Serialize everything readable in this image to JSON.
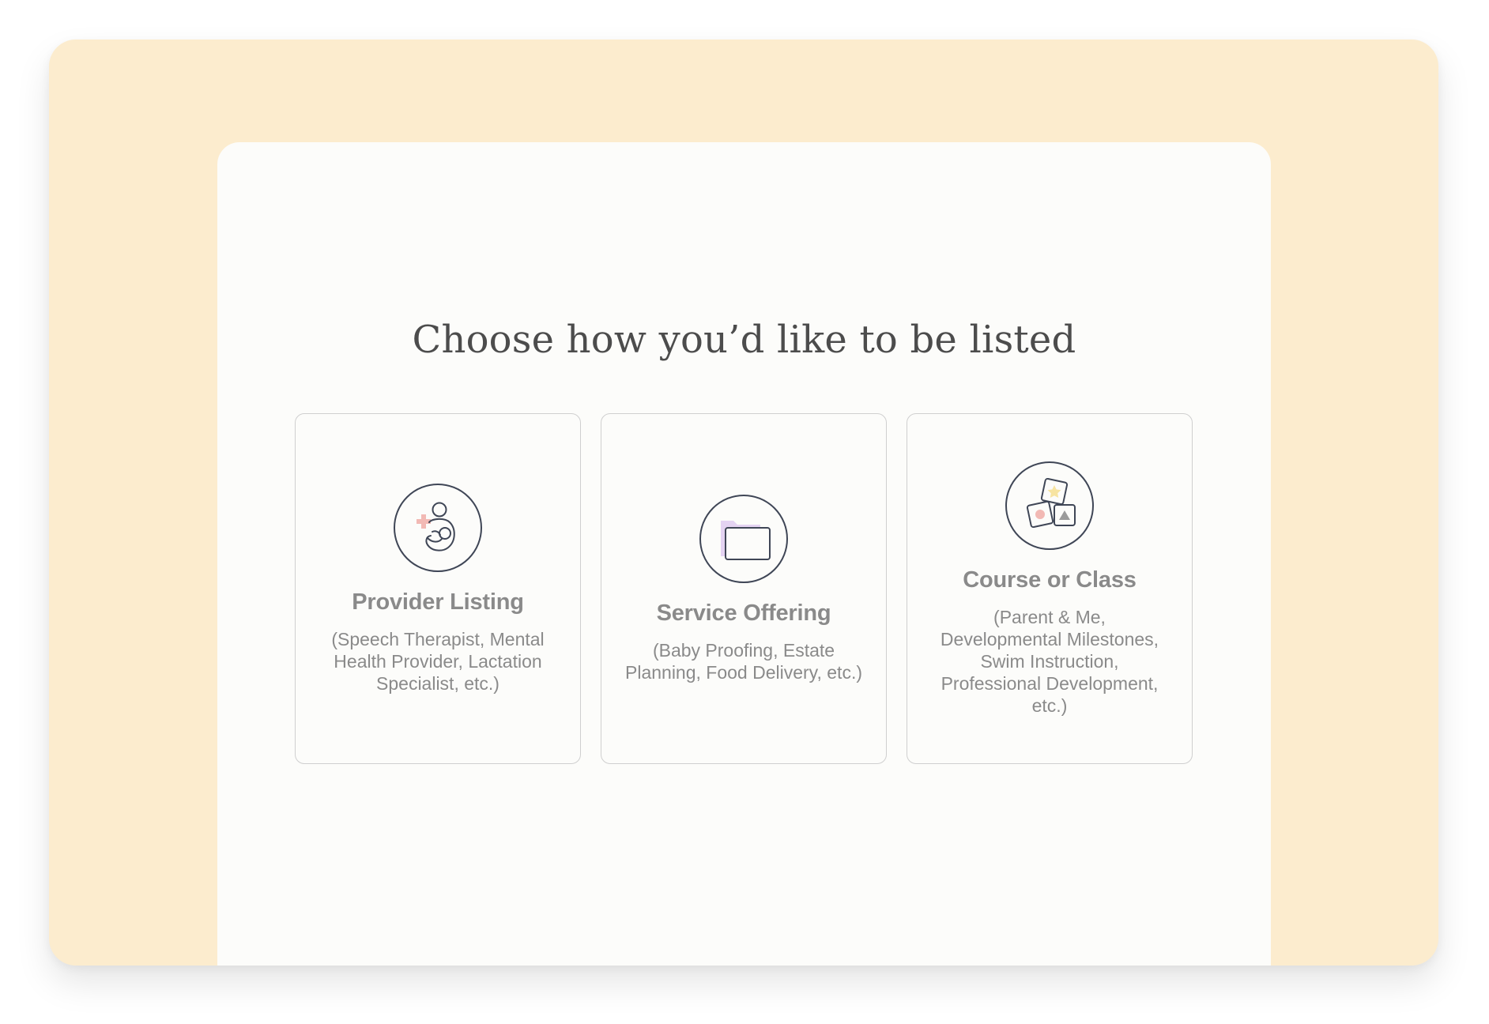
{
  "page": {
    "heading": "Choose how you’d like to be listed"
  },
  "options": [
    {
      "title": "Provider Listing",
      "description": "(Speech Therapist, Mental Health Provider, Lactation Specialist, etc.)",
      "icon": "mother-holding-baby-icon"
    },
    {
      "title": "Service Offering",
      "description": "(Baby Proofing, Estate Planning, Food Delivery, etc.)",
      "icon": "folder-icon"
    },
    {
      "title": "Course or Class",
      "description": "(Parent & Me, Developmental Milestones, Swim Instruction, Professional Development, etc.)",
      "icon": "building-blocks-icon"
    }
  ],
  "colors": {
    "background": "#fcecce",
    "panel": "#fcfcfa",
    "text": "#8a8a8a",
    "heading": "#4c4c4c",
    "icon_stroke": "#3f4656",
    "accent_pink": "#f2b9b4",
    "accent_lavender": "#e4d3f2",
    "accent_yellow": "#f7e4a1"
  }
}
